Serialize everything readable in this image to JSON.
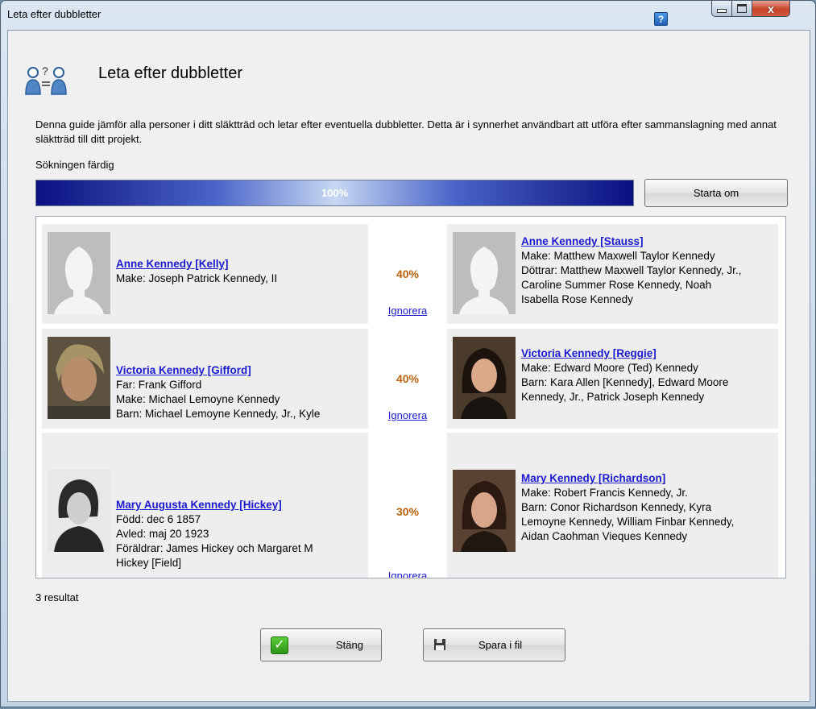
{
  "window": {
    "title": "Leta efter dubbletter",
    "help_label": "?",
    "close_glyph": "x"
  },
  "header": {
    "icon": "find-duplicates-icon",
    "title": "Leta efter dubbletter"
  },
  "description": "Denna guide jämför alla personer i ditt släktträd och letar efter eventuella dubbletter. Detta är i synnerhet användbart att utföra efter sammanslagning med annat släktträd till ditt projekt.",
  "status": "Sökningen färdig",
  "progress": {
    "text": "100%",
    "value": 1.0
  },
  "restart_label": "Starta om",
  "results": [
    {
      "match": "40%",
      "ignore_label": "Ignorera",
      "left": {
        "name": "Anne Kennedy [Kelly]",
        "details": [
          "Make: Joseph Patrick Kennedy, II"
        ],
        "photo": "placeholder-female"
      },
      "right": {
        "name": "Anne Kennedy [Stauss]",
        "details": [
          "Make: Matthew Maxwell Taylor Kennedy",
          "Döttrar: Matthew Maxwell Taylor Kennedy, Jr.,",
          "Caroline Summer Rose Kennedy, Noah",
          "Isabella Rose Kennedy"
        ],
        "photo": "placeholder-female"
      }
    },
    {
      "match": "40%",
      "ignore_label": "Ignorera",
      "left": {
        "name": "Victoria Kennedy [Gifford]",
        "details": [
          "Far: Frank Gifford",
          "Make: Michael Lemoyne Kennedy",
          "Barn: Michael Lemoyne Kennedy, Jr., Kyle"
        ],
        "photo": "photo"
      },
      "right": {
        "name": "Victoria Kennedy [Reggie]",
        "details": [
          "Make: Edward Moore (Ted) Kennedy",
          "Barn: Kara Allen [Kennedy], Edward Moore",
          "Kennedy, Jr., Patrick Joseph Kennedy"
        ],
        "photo": "photo"
      }
    },
    {
      "match": "30%",
      "ignore_label": "Ignorera",
      "left": {
        "name": "Mary Augusta Kennedy [Hickey]",
        "details": [
          "Född: dec 6 1857",
          "Avled: maj 20 1923",
          "Föräldrar: James Hickey och Margaret M",
          "Hickey [Field]"
        ],
        "photo": "photo"
      },
      "right": {
        "name": "Mary Kennedy [Richardson]",
        "details": [
          "Make: Robert Francis Kennedy, Jr.",
          "Barn: Conor Richardson Kennedy, Kyra",
          "Lemoyne Kennedy, William Finbar Kennedy,",
          "Aidan Caohman Vieques Kennedy"
        ],
        "photo": "photo"
      }
    }
  ],
  "result_count": "3 resultat",
  "footer": {
    "close_label": "Stäng",
    "close_icon": "check-icon",
    "save_label": "Spara i fil",
    "save_icon": "floppy-disk-icon"
  },
  "colors": {
    "link": "#1a1acc",
    "match_percent": "#b8630c",
    "progress_dark": "#0a1080"
  }
}
